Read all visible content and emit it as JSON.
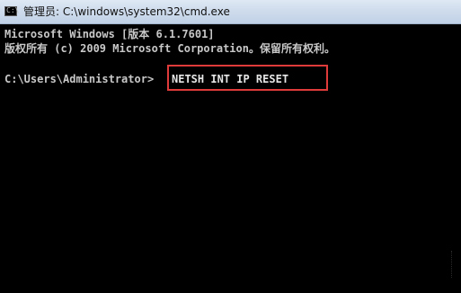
{
  "window": {
    "title": "管理员: C:\\windows\\system32\\cmd.exe",
    "icon": "cmd-icon",
    "icon_glyph": "C:\\"
  },
  "console": {
    "line1": "Microsoft Windows [版本 6.1.7601]",
    "line2": "版权所有 (c) 2009 Microsoft Corporation。保留所有权利。",
    "prompt": "C:\\Users\\Administrator>",
    "command": "NETSH INT IP RESET"
  },
  "colors": {
    "background": "#000000",
    "text": "#c8c8c8",
    "highlight": "#e03b3b"
  }
}
